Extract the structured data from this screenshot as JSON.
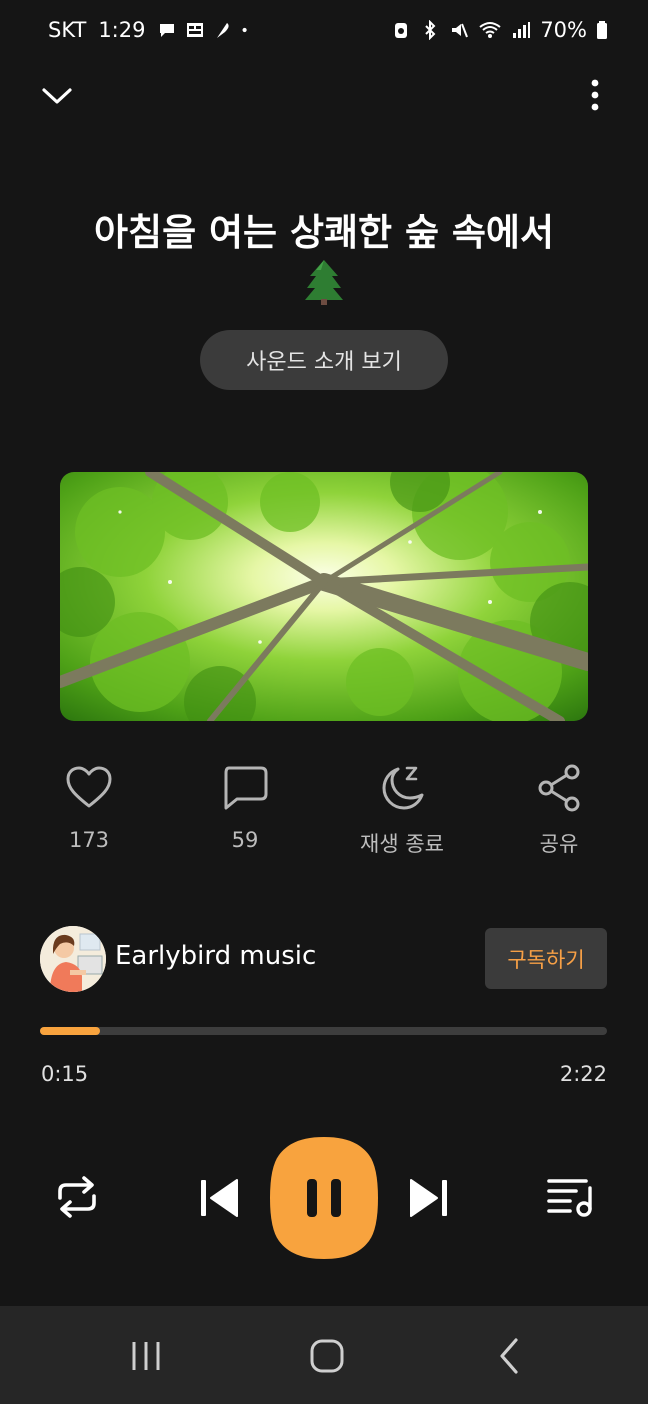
{
  "status_bar": {
    "carrier": "SKT",
    "time": "1:29",
    "battery": "70%",
    "icons_left": [
      "chat-bubble-icon",
      "gallery-icon",
      "feather-icon",
      "dot-icon"
    ],
    "icons_right": [
      "alarm-icon",
      "bluetooth-icon",
      "mute-icon",
      "wifi-icon",
      "signal-icon",
      "battery-icon"
    ]
  },
  "header": {
    "title": "아침을 여는 상쾌한 숲 속에서",
    "title_emoji": "evergreen-tree-icon"
  },
  "intro_button": {
    "label": "사운드 소개 보기"
  },
  "actions": [
    {
      "icon": "heart-icon",
      "label": "173"
    },
    {
      "icon": "comment-icon",
      "label": "59"
    },
    {
      "icon": "moon-sleep-icon",
      "label": "재생 종료"
    },
    {
      "icon": "share-icon",
      "label": "공유"
    }
  ],
  "channel": {
    "name": "Earlybird music",
    "subscribe_label": "구독하기"
  },
  "player": {
    "current_time": "0:15",
    "total_time": "2:22",
    "progress": 0.106
  },
  "controls": [
    "repeat-icon",
    "previous-icon",
    "pause-icon",
    "next-icon",
    "playlist-icon"
  ],
  "nav": [
    "recents-icon",
    "home-icon",
    "back-icon"
  ],
  "colors": {
    "background": "#151515",
    "accent": "#f8a33e",
    "button_bg": "#3b3b3b",
    "nav_bg": "#262626"
  }
}
